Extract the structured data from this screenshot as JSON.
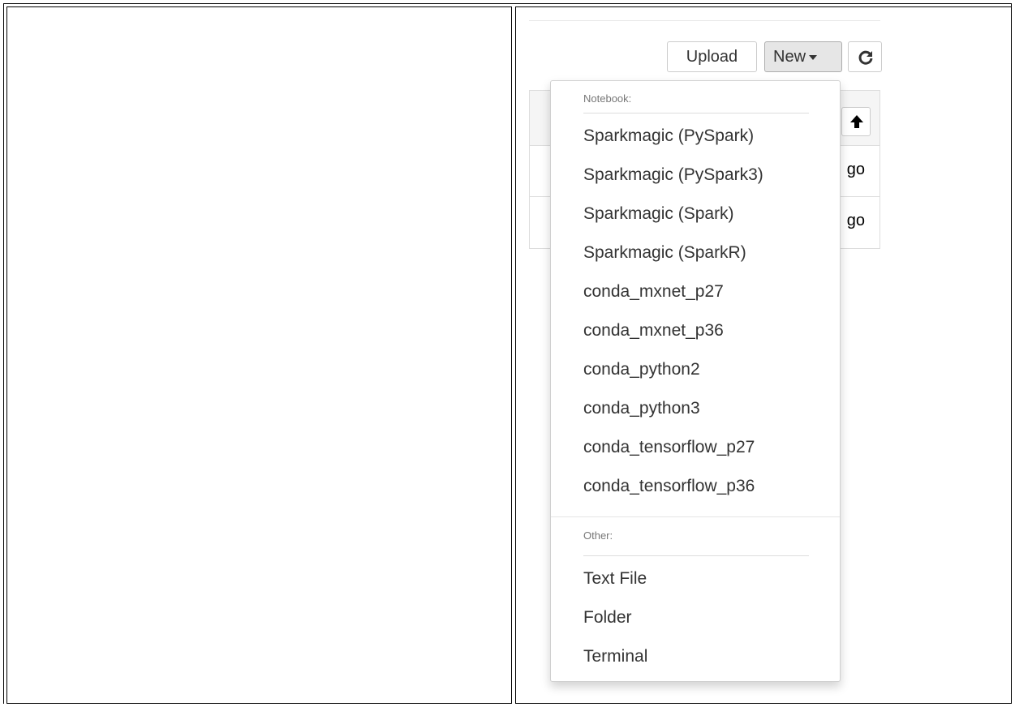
{
  "toolbar": {
    "upload_label": "Upload",
    "new_label": "New",
    "refresh_icon": "refresh-icon"
  },
  "file_list": {
    "sort_icon": "arrow-up-icon",
    "rows": [
      {
        "modified_partial": "go"
      },
      {
        "modified_partial": "go"
      }
    ]
  },
  "new_menu": {
    "notebook_header": "Notebook:",
    "notebook_items": [
      "Sparkmagic (PySpark)",
      "Sparkmagic (PySpark3)",
      "Sparkmagic (Spark)",
      "Sparkmagic (SparkR)",
      "conda_mxnet_p27",
      "conda_mxnet_p36",
      "conda_python2",
      "conda_python3",
      "conda_tensorflow_p27",
      "conda_tensorflow_p36"
    ],
    "other_header": "Other:",
    "other_items": [
      "Text File",
      "Folder",
      "Terminal"
    ]
  }
}
